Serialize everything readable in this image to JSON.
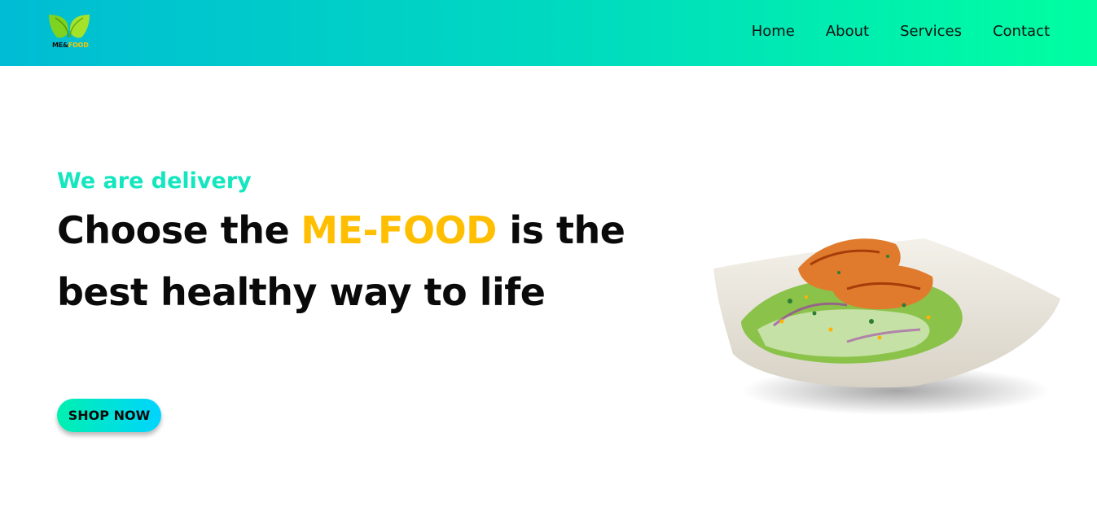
{
  "header": {
    "logo": {
      "text_part1": "ME&",
      "text_part2": "FOOD",
      "icon": "leaf-icon"
    },
    "nav": [
      {
        "label": "Home"
      },
      {
        "label": "About"
      },
      {
        "label": "Services"
      },
      {
        "label": "Contact"
      }
    ]
  },
  "hero": {
    "subtitle": "We are delivery",
    "headline_part1": "Choose the",
    "headline_brand": "ME-FOOD",
    "headline_part2": "is the best healthy way to life",
    "button_label": "SHOP NOW",
    "image": "salad-plate-image"
  },
  "colors": {
    "header_gradient_start": "#00bcd4",
    "header_gradient_end": "#00ffa0",
    "subtitle": "#14e6c0",
    "brand": "#ffbf00",
    "button_gradient_start": "#00f0b0",
    "button_gradient_end": "#00d4ff"
  }
}
